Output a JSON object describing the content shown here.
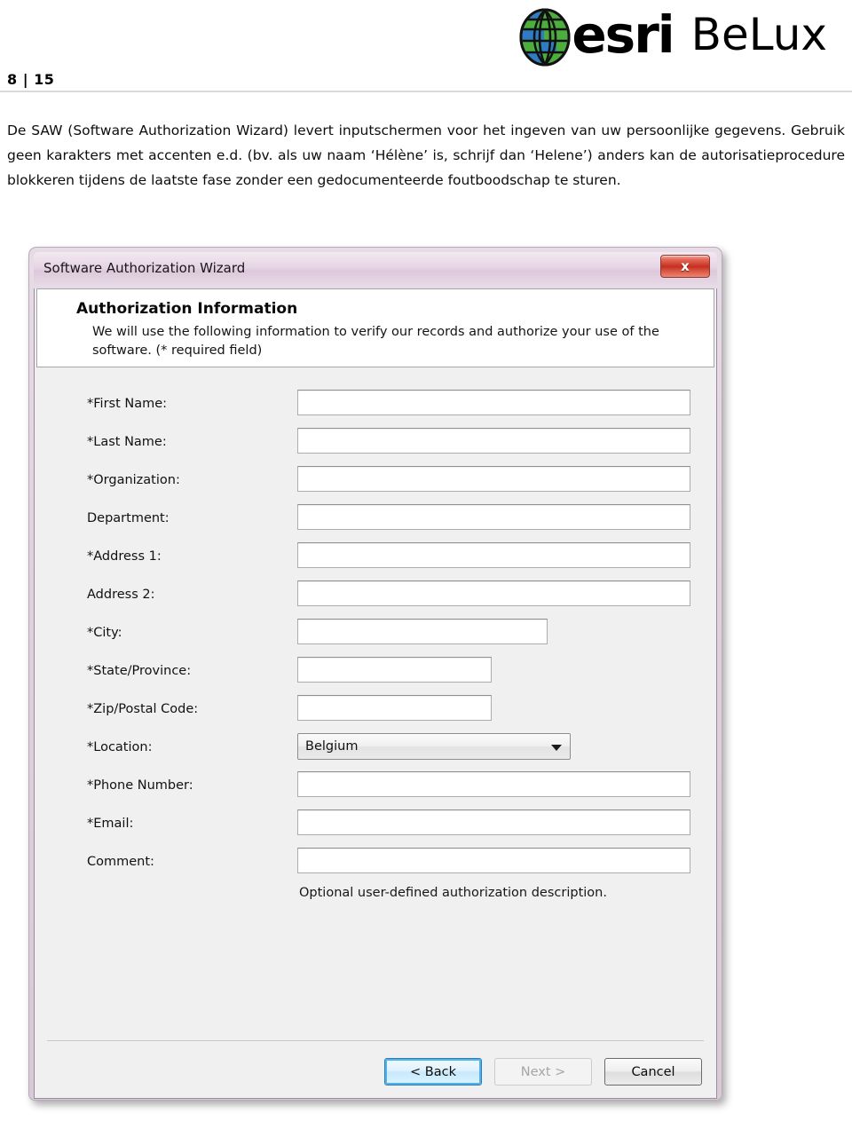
{
  "page": {
    "number_label": "8 | 15",
    "brand_primary": "esri",
    "brand_secondary": "BeLux",
    "globe_blue": "#2e7cc4",
    "globe_green": "#4caf3d"
  },
  "body": {
    "paragraph_lines": [
      "De SAW (Software Authorization Wizard) levert inputschermen voor het ingeven van uw persoonlijke",
      "gegevens. Gebruik geen karakters met accenten e.d. (bv. als uw naam ‘Hélène’ is, schrijf dan ‘Helene’)",
      "anders kan de autorisatieprocedure blokkeren tijdens de laatste fase zonder een gedocumenteerde",
      "foutboodschap te sturen."
    ]
  },
  "dialog": {
    "title": "Software Authorization Wizard",
    "close_label": "x",
    "banner": {
      "heading": "Authorization Information",
      "description": "We will use the following information to verify our records and authorize your use of the software. (* required field)"
    },
    "fields": [
      {
        "label": "*First Name:",
        "type": "text",
        "value": "",
        "width": "w-full"
      },
      {
        "label": "*Last Name:",
        "type": "text",
        "value": "",
        "width": "w-full"
      },
      {
        "label": "*Organization:",
        "type": "text",
        "value": "",
        "width": "w-full"
      },
      {
        "label": "Department:",
        "type": "text",
        "value": "",
        "width": "w-full"
      },
      {
        "label": "*Address 1:",
        "type": "text",
        "value": "",
        "width": "w-full"
      },
      {
        "label": "Address 2:",
        "type": "text",
        "value": "",
        "width": "w-full"
      },
      {
        "label": "*City:",
        "type": "text",
        "value": "",
        "width": "w-city"
      },
      {
        "label": "*State/Province:",
        "type": "text",
        "value": "",
        "width": "w-small"
      },
      {
        "label": "*Zip/Postal Code:",
        "type": "text",
        "value": "",
        "width": "w-small"
      },
      {
        "label": "*Location:",
        "type": "combo",
        "value": "Belgium",
        "width": ""
      },
      {
        "label": "*Phone Number:",
        "type": "text",
        "value": "",
        "width": "w-full"
      },
      {
        "label": "*Email:",
        "type": "text",
        "value": "",
        "width": "w-full"
      },
      {
        "label": "Comment:",
        "type": "text",
        "value": "",
        "width": "w-full"
      }
    ],
    "comment_hint": "Optional user-defined authorization description.",
    "buttons": {
      "back": "< Back",
      "next": "Next >",
      "cancel": "Cancel"
    }
  }
}
